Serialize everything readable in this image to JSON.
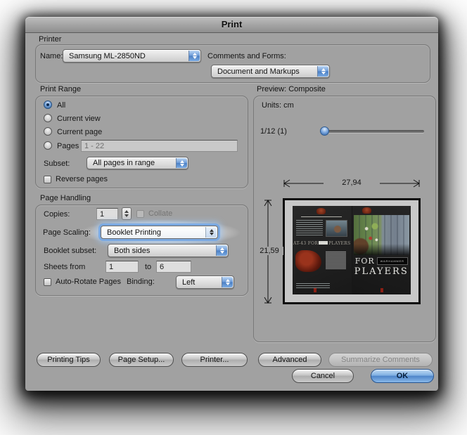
{
  "window": {
    "title": "Print"
  },
  "printer": {
    "section_label": "Printer",
    "name_label": "Name:",
    "name_value": "Samsung ML-2850ND",
    "comments_label": "Comments and Forms:",
    "comments_value": "Document and Markups"
  },
  "print_range": {
    "section_label": "Print Range",
    "options": [
      {
        "label": "All"
      },
      {
        "label": "Current view"
      },
      {
        "label": "Current page"
      },
      {
        "label": "Pages"
      }
    ],
    "selected_option": "All",
    "pages_value": "1 - 22",
    "subset_label": "Subset:",
    "subset_value": "All pages in range",
    "reverse_label": "Reverse pages"
  },
  "page_handling": {
    "section_label": "Page Handling",
    "copies_label": "Copies:",
    "copies_value": "1",
    "collate_label": "Collate",
    "page_scaling_label": "Page Scaling:",
    "page_scaling_value": "Booklet Printing",
    "booklet_subset_label": "Booklet subset:",
    "booklet_subset_value": "Both sides",
    "sheets_from_label": "Sheets from",
    "sheets_from_value": "1",
    "sheets_to_label": "to",
    "sheets_to_value": "6",
    "auto_rotate_label": "Auto-Rotate Pages",
    "binding_label": "Binding:",
    "binding_value": "Left"
  },
  "preview": {
    "section_label": "Preview: Composite",
    "units_label": "Units: cm",
    "zoom_indicator": "1/12 (1)",
    "width_dim": "27,94",
    "height_dim": "21,59",
    "thumbnail": {
      "left_title": "AT-43 FOR",
      "left_title2": "PLAYERS",
      "right_for": "FOR",
      "right_badge": "WARHAMMER",
      "right_players": "PLAYERS"
    }
  },
  "buttons": {
    "printing_tips": "Printing Tips",
    "page_setup": "Page Setup...",
    "printer": "Printer...",
    "advanced": "Advanced",
    "summarize_comments": "Summarize Comments",
    "cancel": "Cancel",
    "ok": "OK"
  },
  "colors": {
    "accent_blue": "#5b8cd6",
    "ok_button": "#4d86c8",
    "highlight_glow": "#ffffff",
    "dialog_bg": "#a1a1a1"
  }
}
